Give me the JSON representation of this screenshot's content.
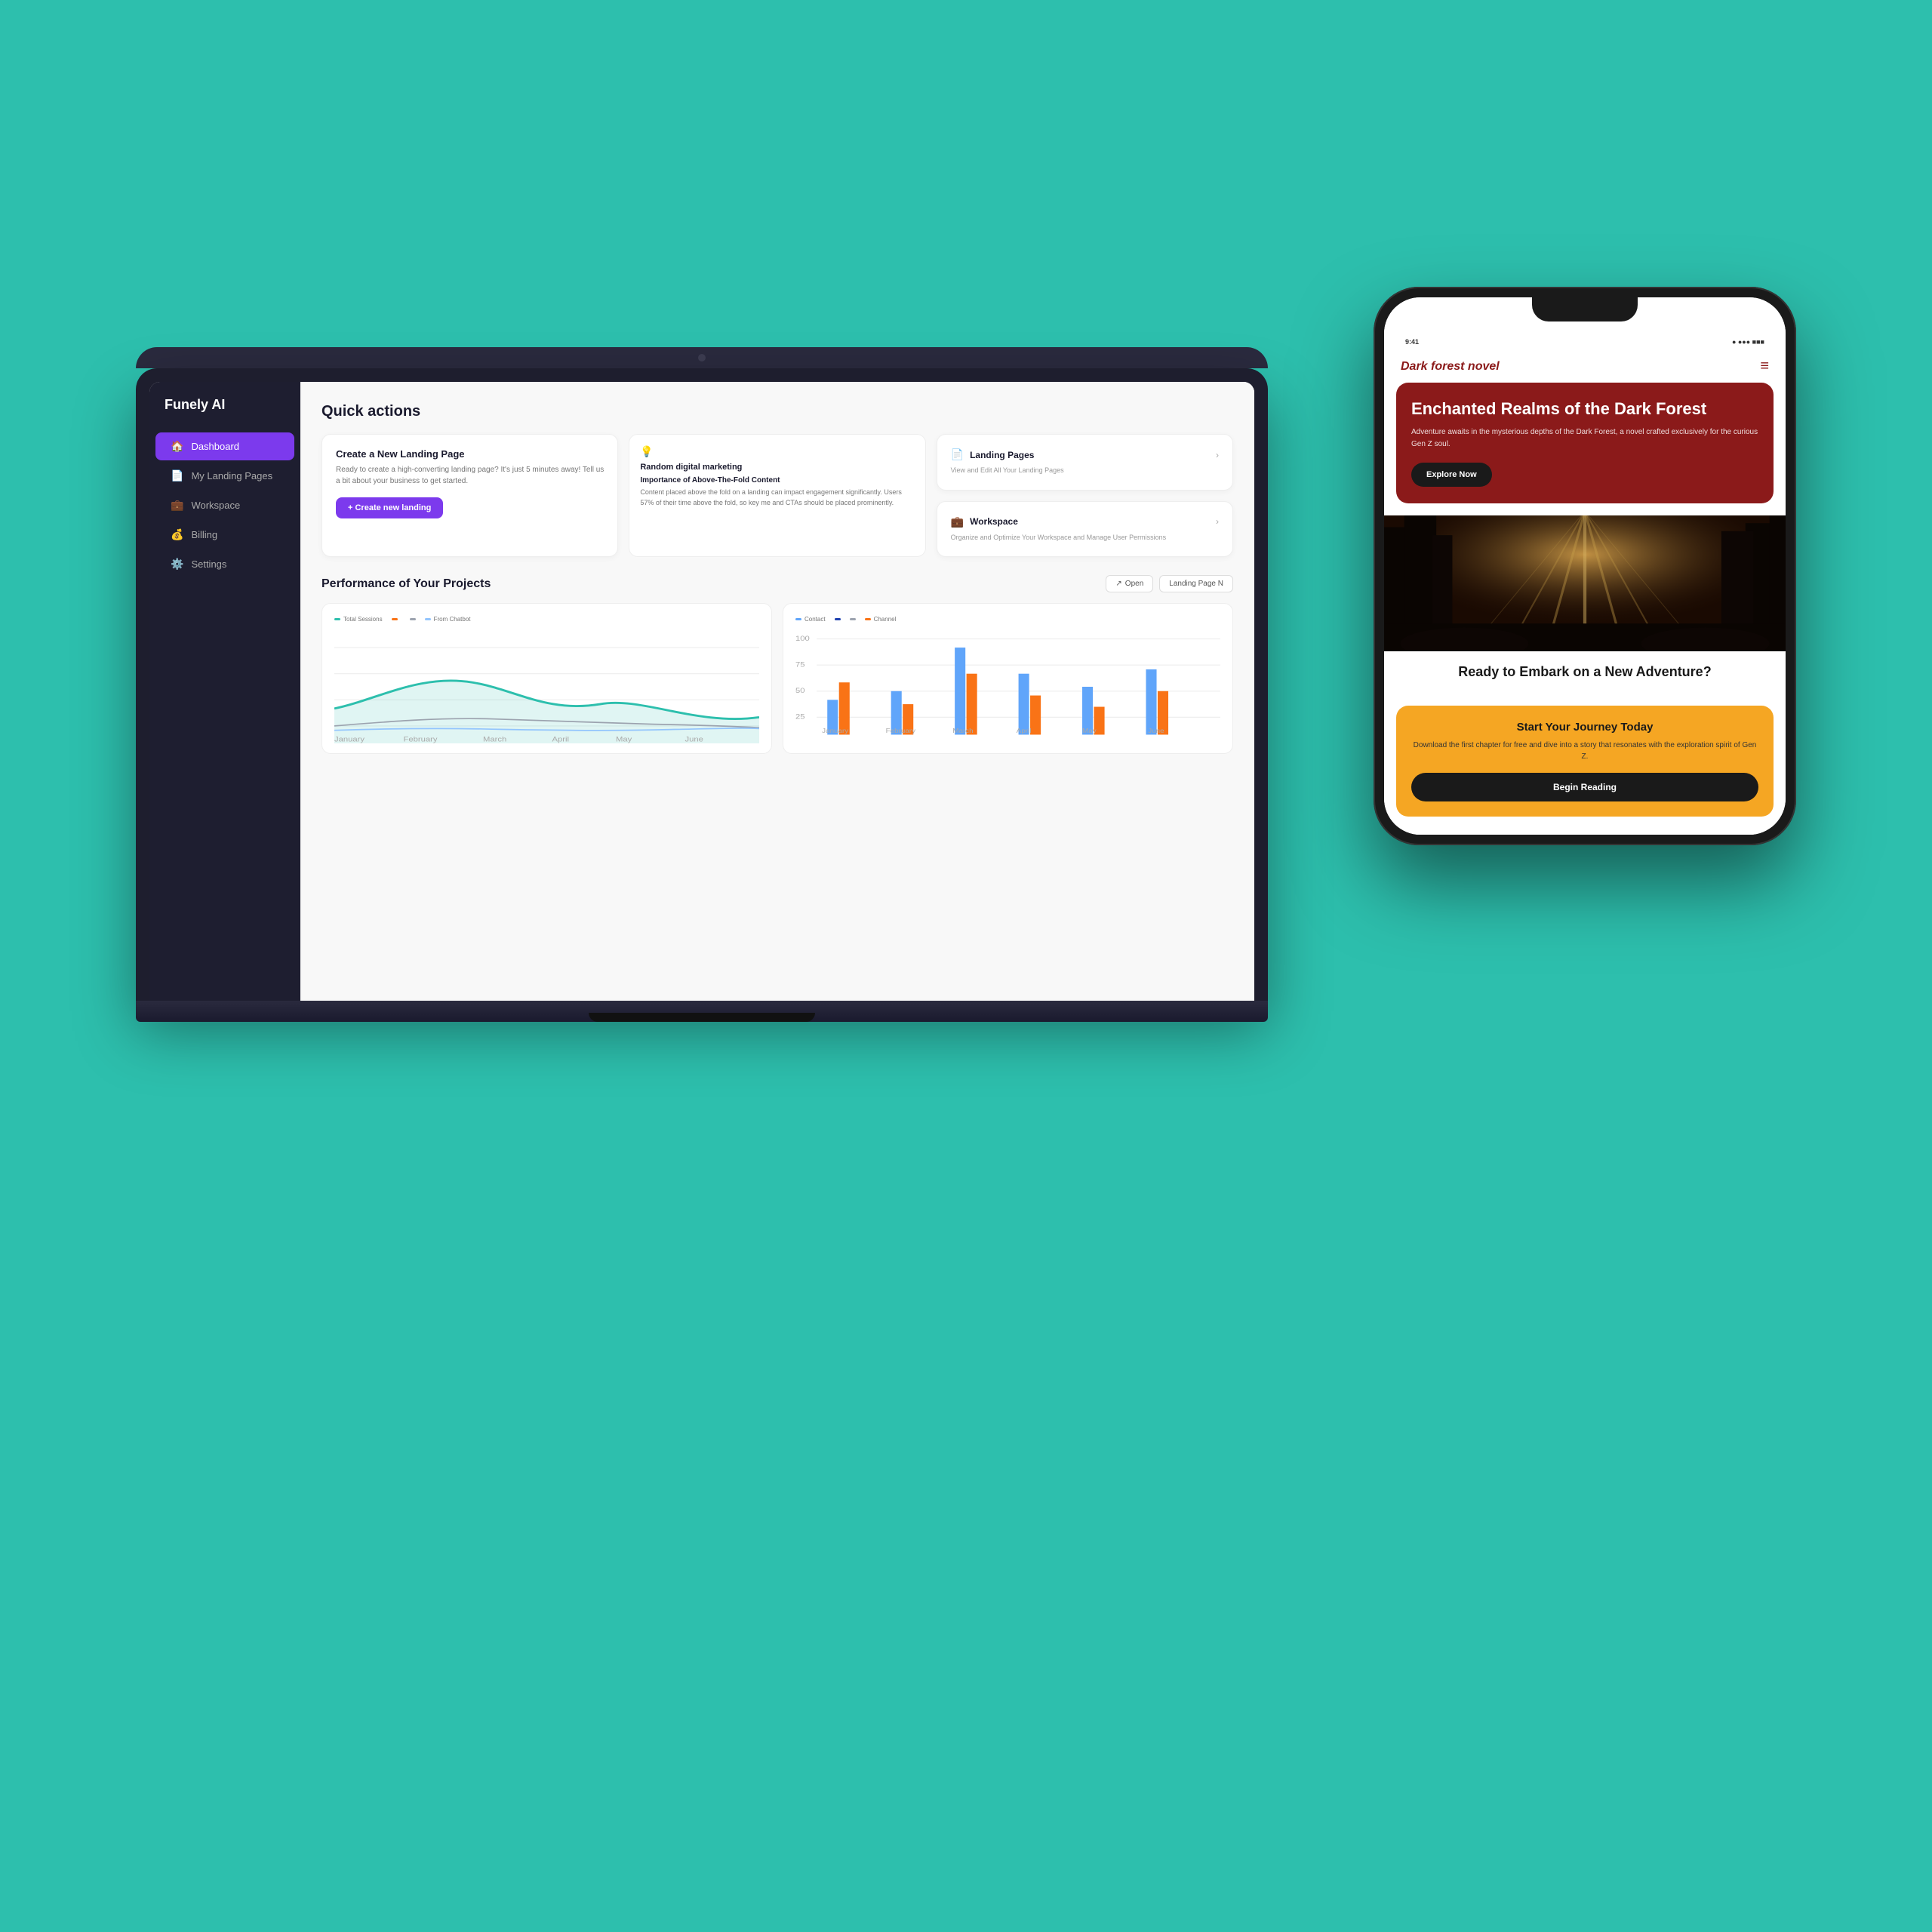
{
  "background_color": "#2DBFAD",
  "laptop": {
    "brand": "Funely AI",
    "sidebar": {
      "items": [
        {
          "label": "Dashboard",
          "icon": "🏠",
          "active": true
        },
        {
          "label": "My Landing Pages",
          "icon": "📄",
          "active": false
        },
        {
          "label": "Workspace",
          "icon": "💼",
          "active": false
        },
        {
          "label": "Billing",
          "icon": "💰",
          "active": false
        },
        {
          "label": "Settings",
          "icon": "⚙️",
          "active": false
        }
      ]
    },
    "main": {
      "quick_actions_title": "Quick actions",
      "create_card": {
        "title": "Create a New Landing Page",
        "description": "Ready to create a high-converting landing page? It's just 5 minutes away! Tell us a bit about your business to get started.",
        "button_label": "+ Create new landing"
      },
      "landing_pages_card": {
        "icon": "📄",
        "title": "Landing Pages",
        "description": "View and Edit All Your Landing Pages",
        "chevron": "›"
      },
      "workspace_card": {
        "icon": "💼",
        "title": "Workspace",
        "description": "Organize and Optimize Your Workspace and Manage User Permissions",
        "chevron": "›"
      },
      "tip_card": {
        "icon": "💡",
        "title": "Random digital marketing",
        "subtitle": "Importance of Above-The-Fold Content",
        "description": "Content placed above the fold on a landing can impact engagement significantly. Users 57% of their time above the fold, so key me and CTAs should be placed prominently."
      },
      "performance_title": "Performance of Your Projects",
      "perf_buttons": [
        "Open",
        "Landing Page N"
      ],
      "chart_left": {
        "legend": [
          {
            "label": "Total Sessions",
            "color": "#2DBFAD"
          },
          {
            "label": "",
            "color": "#f97316"
          },
          {
            "label": "",
            "color": "#6b7280"
          },
          {
            "label": "From Chatbot",
            "color": "#93c5fd"
          }
        ],
        "x_labels": [
          "January",
          "February",
          "March",
          "April",
          "May",
          "June"
        ]
      },
      "chart_right": {
        "legend": [
          {
            "label": "Contact",
            "color": "#60a5fa"
          },
          {
            "label": "",
            "color": "#1e40af"
          },
          {
            "label": "",
            "color": "#6b7280"
          },
          {
            "label": "Channel",
            "color": "#f97316"
          }
        ],
        "x_labels": [
          "January",
          "February",
          "March",
          "April",
          "May",
          "June"
        ]
      }
    }
  },
  "phone": {
    "nav": {
      "logo": "Dark forest novel",
      "menu_icon": "≡"
    },
    "hero": {
      "title": "Enchanted Realms of the Dark Forest",
      "description": "Adventure awaits in the mysterious depths of the Dark Forest, a novel crafted exclusively for the curious Gen Z soul.",
      "button_label": "Explore Now"
    },
    "adventure": {
      "title": "Ready to Embark on a New Adventure?"
    },
    "cta": {
      "title": "Start Your Journey Today",
      "description": "Download the first chapter for free and dive into a story that resonates with the exploration spirit of Gen Z.",
      "button_label": "Begin Reading"
    }
  }
}
